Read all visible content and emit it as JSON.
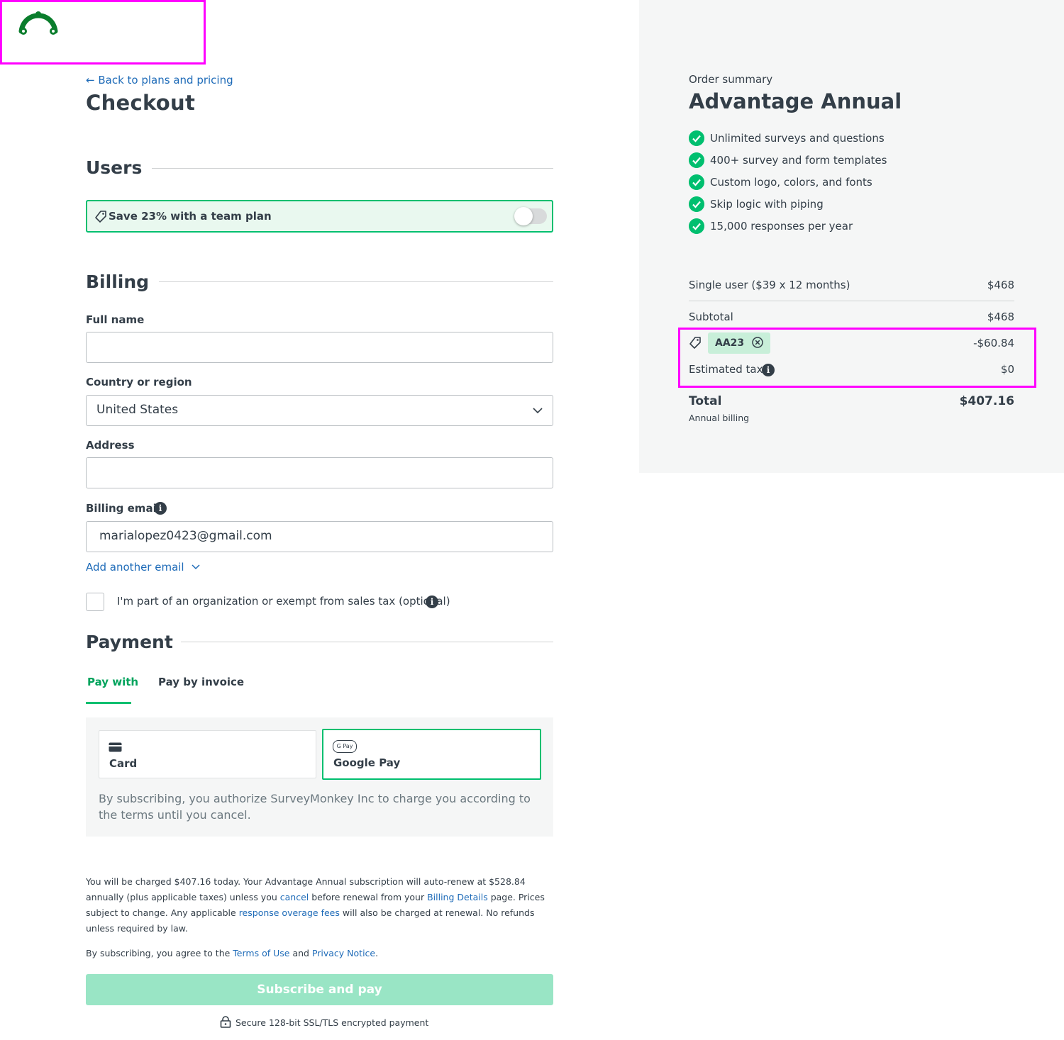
{
  "header": {
    "back_link": "Back to plans and pricing",
    "title": "Checkout"
  },
  "users": {
    "heading": "Users",
    "team_promo": "Save 23% with a team plan",
    "team_toggle_on": false
  },
  "billing": {
    "heading": "Billing",
    "full_name_label": "Full name",
    "full_name_value": "",
    "country_label": "Country or region",
    "country_value": "United States",
    "address_label": "Address",
    "address_value": "",
    "email_label": "Billing email",
    "email_value": "marialopez0423@gmail.com",
    "add_email": "Add another email",
    "exempt_label": "I'm part of an organization or exempt from sales tax (optional)"
  },
  "payment": {
    "heading": "Payment",
    "tabs": [
      {
        "label": "Pay with",
        "active": true
      },
      {
        "label": "Pay by invoice",
        "active": false
      }
    ],
    "methods": [
      {
        "label": "Card",
        "selected": false
      },
      {
        "label": "Google Pay",
        "selected": true
      }
    ],
    "gpay_badge": "G Pay",
    "authorize_note": "By subscribing, you authorize SurveyMonkey Inc to charge you according to the terms until you cancel."
  },
  "legal": {
    "p1_a": "You will be charged $407.16 today. Your Advantage Annual subscription will auto-renew at $528.84 annually (plus applicable taxes) unless you ",
    "p1_cancel": "cancel",
    "p1_b": " before renewal from your ",
    "p1_billing": "Billing Details",
    "p1_c": " page. Prices subject to change. Any applicable ",
    "p1_overage": "response overage fees",
    "p1_d": " will also be charged at renewal. No refunds unless required by law.",
    "p2_a": "By subscribing, you agree to the ",
    "p2_terms": "Terms of Use",
    "p2_b": " and ",
    "p2_privacy": "Privacy Notice",
    "p2_c": "."
  },
  "subscribe_button": "Subscribe and pay",
  "secure_note": "Secure 128-bit SSL/TLS encrypted payment",
  "summary": {
    "label": "Order summary",
    "plan": "Advantage Annual",
    "features": [
      "Unlimited surveys and questions",
      "400+ survey and form templates",
      "Custom logo, colors, and fonts",
      "Skip logic with piping",
      "15,000 responses per year"
    ],
    "line_item": {
      "label": "Single user ($39 x 12 months)",
      "amount": "$468"
    },
    "subtotal": {
      "label": "Subtotal",
      "amount": "$468"
    },
    "coupon": {
      "code": "AA23",
      "amount": "-$60.84"
    },
    "tax": {
      "label": "Estimated tax",
      "amount": "$0"
    },
    "total": {
      "label": "Total",
      "amount": "$407.16",
      "note": "Annual billing"
    }
  },
  "colors": {
    "brand_green": "#00bf6f",
    "logo_green": "#0a7d2c",
    "link_blue": "#1e6bb8",
    "highlight": "#ff00ff"
  }
}
